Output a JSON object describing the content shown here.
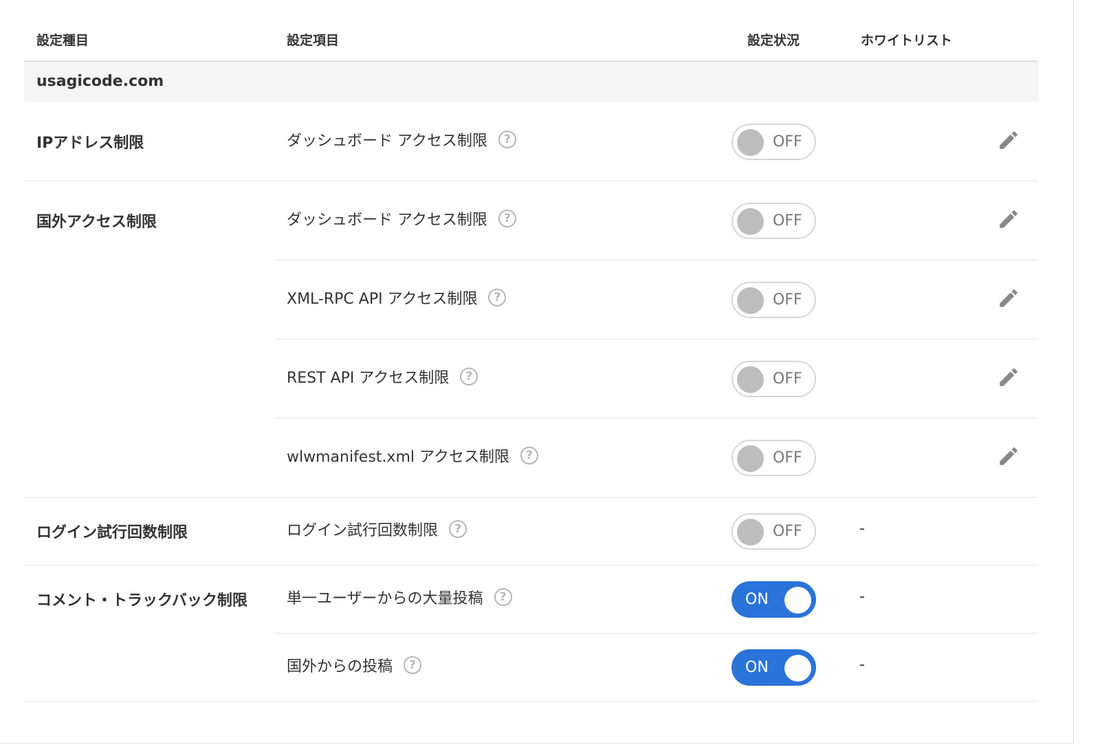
{
  "header": {
    "col_category": "設定種目",
    "col_item": "設定項目",
    "col_status": "設定状況",
    "col_whitelist": "ホワイトリスト"
  },
  "domain": "usagicode.com",
  "groups": [
    {
      "category": "IPアドレス制限",
      "rows": [
        {
          "label": "ダッシュボード アクセス制限",
          "help": "?",
          "status": "OFF",
          "whitelist": "edit-icon"
        }
      ]
    },
    {
      "category": "国外アクセス制限",
      "rows": [
        {
          "label": "ダッシュボード アクセス制限",
          "help": "?",
          "status": "OFF",
          "whitelist": "edit-icon"
        },
        {
          "label": "XML-RPC API アクセス制限",
          "help": "?",
          "status": "OFF",
          "whitelist": "edit-icon"
        },
        {
          "label": "REST API アクセス制限",
          "help": "?",
          "status": "OFF",
          "whitelist": "edit-icon"
        },
        {
          "label": "wlwmanifest.xml アクセス制限",
          "help": "?",
          "status": "OFF",
          "whitelist": "edit-icon"
        }
      ]
    },
    {
      "category": "ログイン試行回数制限",
      "rows": [
        {
          "label": "ログイン試行回数制限",
          "help": "?",
          "status": "OFF",
          "whitelist": "-"
        }
      ]
    },
    {
      "category": "コメント・トラックバック制限",
      "rows": [
        {
          "label": "単一ユーザーからの大量投稿",
          "help": "?",
          "status": "ON",
          "whitelist": "-"
        },
        {
          "label": "国外からの投稿",
          "help": "?",
          "status": "ON",
          "whitelist": "-"
        }
      ]
    }
  ],
  "colors": {
    "toggle_on": "#2a73d9",
    "toggle_off_knob": "#bdbdbd",
    "domain_bar": "#f5f5f5",
    "icon_gray": "#888888"
  }
}
